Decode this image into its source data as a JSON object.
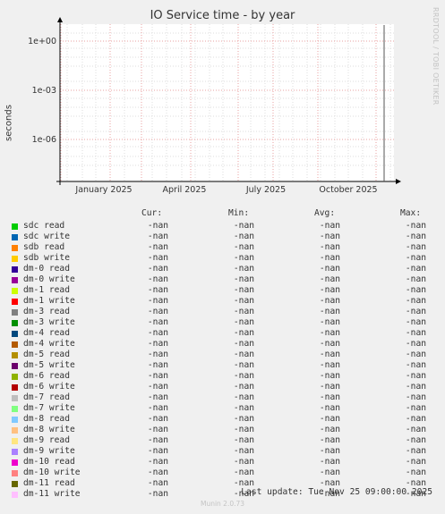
{
  "title": "IO Service time - by year",
  "side_note": "RRDTOOL / TOBI OETIKER",
  "ylabel": "seconds",
  "columns": {
    "cur": "Cur:",
    "min": "Min:",
    "avg": "Avg:",
    "max": "Max:"
  },
  "last_update": "Last update: Tue Nov 25 09:00:00 2025",
  "footer": "Munin 2.0.73",
  "colors": {
    "background": "#f0f0f0",
    "plot_bg": "#ffffff",
    "major_grid": "#e8a0a0",
    "minor_grid": "#dddddd",
    "axis": "#000000",
    "spike": "#555555"
  },
  "chart_data": {
    "type": "line",
    "title": "IO Service time - by year",
    "xlabel": "",
    "ylabel": "seconds",
    "yscale": "log",
    "y_ticks": [
      "1e+00",
      "1e-03",
      "1e-06"
    ],
    "x_ticks": [
      "January 2025",
      "April 2025",
      "July 2025",
      "October 2025"
    ],
    "grid": true,
    "series": [
      {
        "name": "sdc read",
        "color": "#00cc00",
        "cur": "-nan",
        "min": "-nan",
        "avg": "-nan",
        "max": "-nan"
      },
      {
        "name": "sdc write",
        "color": "#0066b3",
        "cur": "-nan",
        "min": "-nan",
        "avg": "-nan",
        "max": "-nan"
      },
      {
        "name": "sdb read",
        "color": "#ff8000",
        "cur": "-nan",
        "min": "-nan",
        "avg": "-nan",
        "max": "-nan"
      },
      {
        "name": "sdb write",
        "color": "#ffcc00",
        "cur": "-nan",
        "min": "-nan",
        "avg": "-nan",
        "max": "-nan"
      },
      {
        "name": "dm-0 read",
        "color": "#330099",
        "cur": "-nan",
        "min": "-nan",
        "avg": "-nan",
        "max": "-nan"
      },
      {
        "name": "dm-0 write",
        "color": "#990099",
        "cur": "-nan",
        "min": "-nan",
        "avg": "-nan",
        "max": "-nan"
      },
      {
        "name": "dm-1 read",
        "color": "#ccff00",
        "cur": "-nan",
        "min": "-nan",
        "avg": "-nan",
        "max": "-nan"
      },
      {
        "name": "dm-1 write",
        "color": "#ff0000",
        "cur": "-nan",
        "min": "-nan",
        "avg": "-nan",
        "max": "-nan"
      },
      {
        "name": "dm-3 read",
        "color": "#808080",
        "cur": "-nan",
        "min": "-nan",
        "avg": "-nan",
        "max": "-nan"
      },
      {
        "name": "dm-3 write",
        "color": "#008f00",
        "cur": "-nan",
        "min": "-nan",
        "avg": "-nan",
        "max": "-nan"
      },
      {
        "name": "dm-4 read",
        "color": "#00487d",
        "cur": "-nan",
        "min": "-nan",
        "avg": "-nan",
        "max": "-nan"
      },
      {
        "name": "dm-4 write",
        "color": "#b35a00",
        "cur": "-nan",
        "min": "-nan",
        "avg": "-nan",
        "max": "-nan"
      },
      {
        "name": "dm-5 read",
        "color": "#b38f00",
        "cur": "-nan",
        "min": "-nan",
        "avg": "-nan",
        "max": "-nan"
      },
      {
        "name": "dm-5 write",
        "color": "#6b006b",
        "cur": "-nan",
        "min": "-nan",
        "avg": "-nan",
        "max": "-nan"
      },
      {
        "name": "dm-6 read",
        "color": "#8fb300",
        "cur": "-nan",
        "min": "-nan",
        "avg": "-nan",
        "max": "-nan"
      },
      {
        "name": "dm-6 write",
        "color": "#b30000",
        "cur": "-nan",
        "min": "-nan",
        "avg": "-nan",
        "max": "-nan"
      },
      {
        "name": "dm-7 read",
        "color": "#bebebe",
        "cur": "-nan",
        "min": "-nan",
        "avg": "-nan",
        "max": "-nan"
      },
      {
        "name": "dm-7 write",
        "color": "#80ff80",
        "cur": "-nan",
        "min": "-nan",
        "avg": "-nan",
        "max": "-nan"
      },
      {
        "name": "dm-8 read",
        "color": "#80c9ff",
        "cur": "-nan",
        "min": "-nan",
        "avg": "-nan",
        "max": "-nan"
      },
      {
        "name": "dm-8 write",
        "color": "#ffc080",
        "cur": "-nan",
        "min": "-nan",
        "avg": "-nan",
        "max": "-nan"
      },
      {
        "name": "dm-9 read",
        "color": "#ffe680",
        "cur": "-nan",
        "min": "-nan",
        "avg": "-nan",
        "max": "-nan"
      },
      {
        "name": "dm-9 write",
        "color": "#aa80ff",
        "cur": "-nan",
        "min": "-nan",
        "avg": "-nan",
        "max": "-nan"
      },
      {
        "name": "dm-10 read",
        "color": "#ee00cc",
        "cur": "-nan",
        "min": "-nan",
        "avg": "-nan",
        "max": "-nan"
      },
      {
        "name": "dm-10 write",
        "color": "#ff8080",
        "cur": "-nan",
        "min": "-nan",
        "avg": "-nan",
        "max": "-nan"
      },
      {
        "name": "dm-11 read",
        "color": "#666600",
        "cur": "-nan",
        "min": "-nan",
        "avg": "-nan",
        "max": "-nan"
      },
      {
        "name": "dm-11 write",
        "color": "#ffbfff",
        "cur": "-nan",
        "min": "-nan",
        "avg": "-nan",
        "max": "-nan"
      }
    ]
  }
}
